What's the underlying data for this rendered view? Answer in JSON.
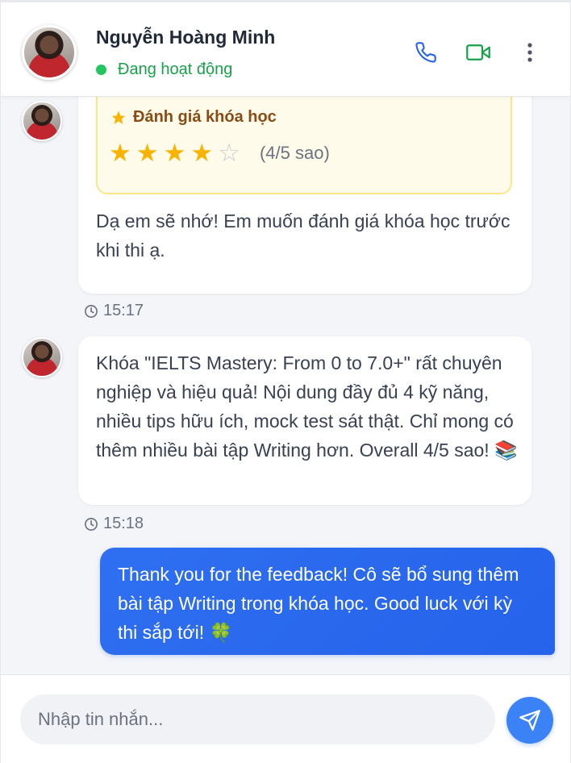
{
  "header": {
    "contact_name": "Nguyễn Hoàng Minh",
    "status_text": "Đang hoạt động",
    "icons": {
      "call": "phone-icon",
      "video": "video-camera-icon",
      "more": "more-vertical-icon"
    },
    "colors": {
      "call_icon": "#2563eb",
      "video_icon": "#16a34a",
      "status": "#22c55e"
    }
  },
  "messages": [
    {
      "sender": "contact",
      "rating_card": {
        "title": "Đánh giá khóa học",
        "rating": 4,
        "max_rating": 5,
        "score_text": "(4/5 sao)"
      },
      "text": "Dạ em sẽ nhớ! Em muốn đánh giá khóa học trước khi thi ạ.",
      "time": "15:17"
    },
    {
      "sender": "contact",
      "text": "Khóa \"IELTS Mastery: From 0 to 7.0+\" rất chuyên nghiệp và hiệu quả! Nội dung đầy đủ 4 kỹ năng, nhiều tips hữu ích, mock test sát thật. Chỉ mong có thêm nhiều bài tập Writing hơn. Overall 4/5 sao! 📚",
      "time": "15:18"
    },
    {
      "sender": "me",
      "text": "Thank you for the feedback! Cô sẽ bổ sung thêm bài tập Writing trong khóa học. Good luck với kỳ thi sắp tới! 🍀"
    }
  ],
  "composer": {
    "placeholder": "Nhập tin nhắn...",
    "send_icon": "send-icon",
    "send_color": "#3b82f6"
  }
}
